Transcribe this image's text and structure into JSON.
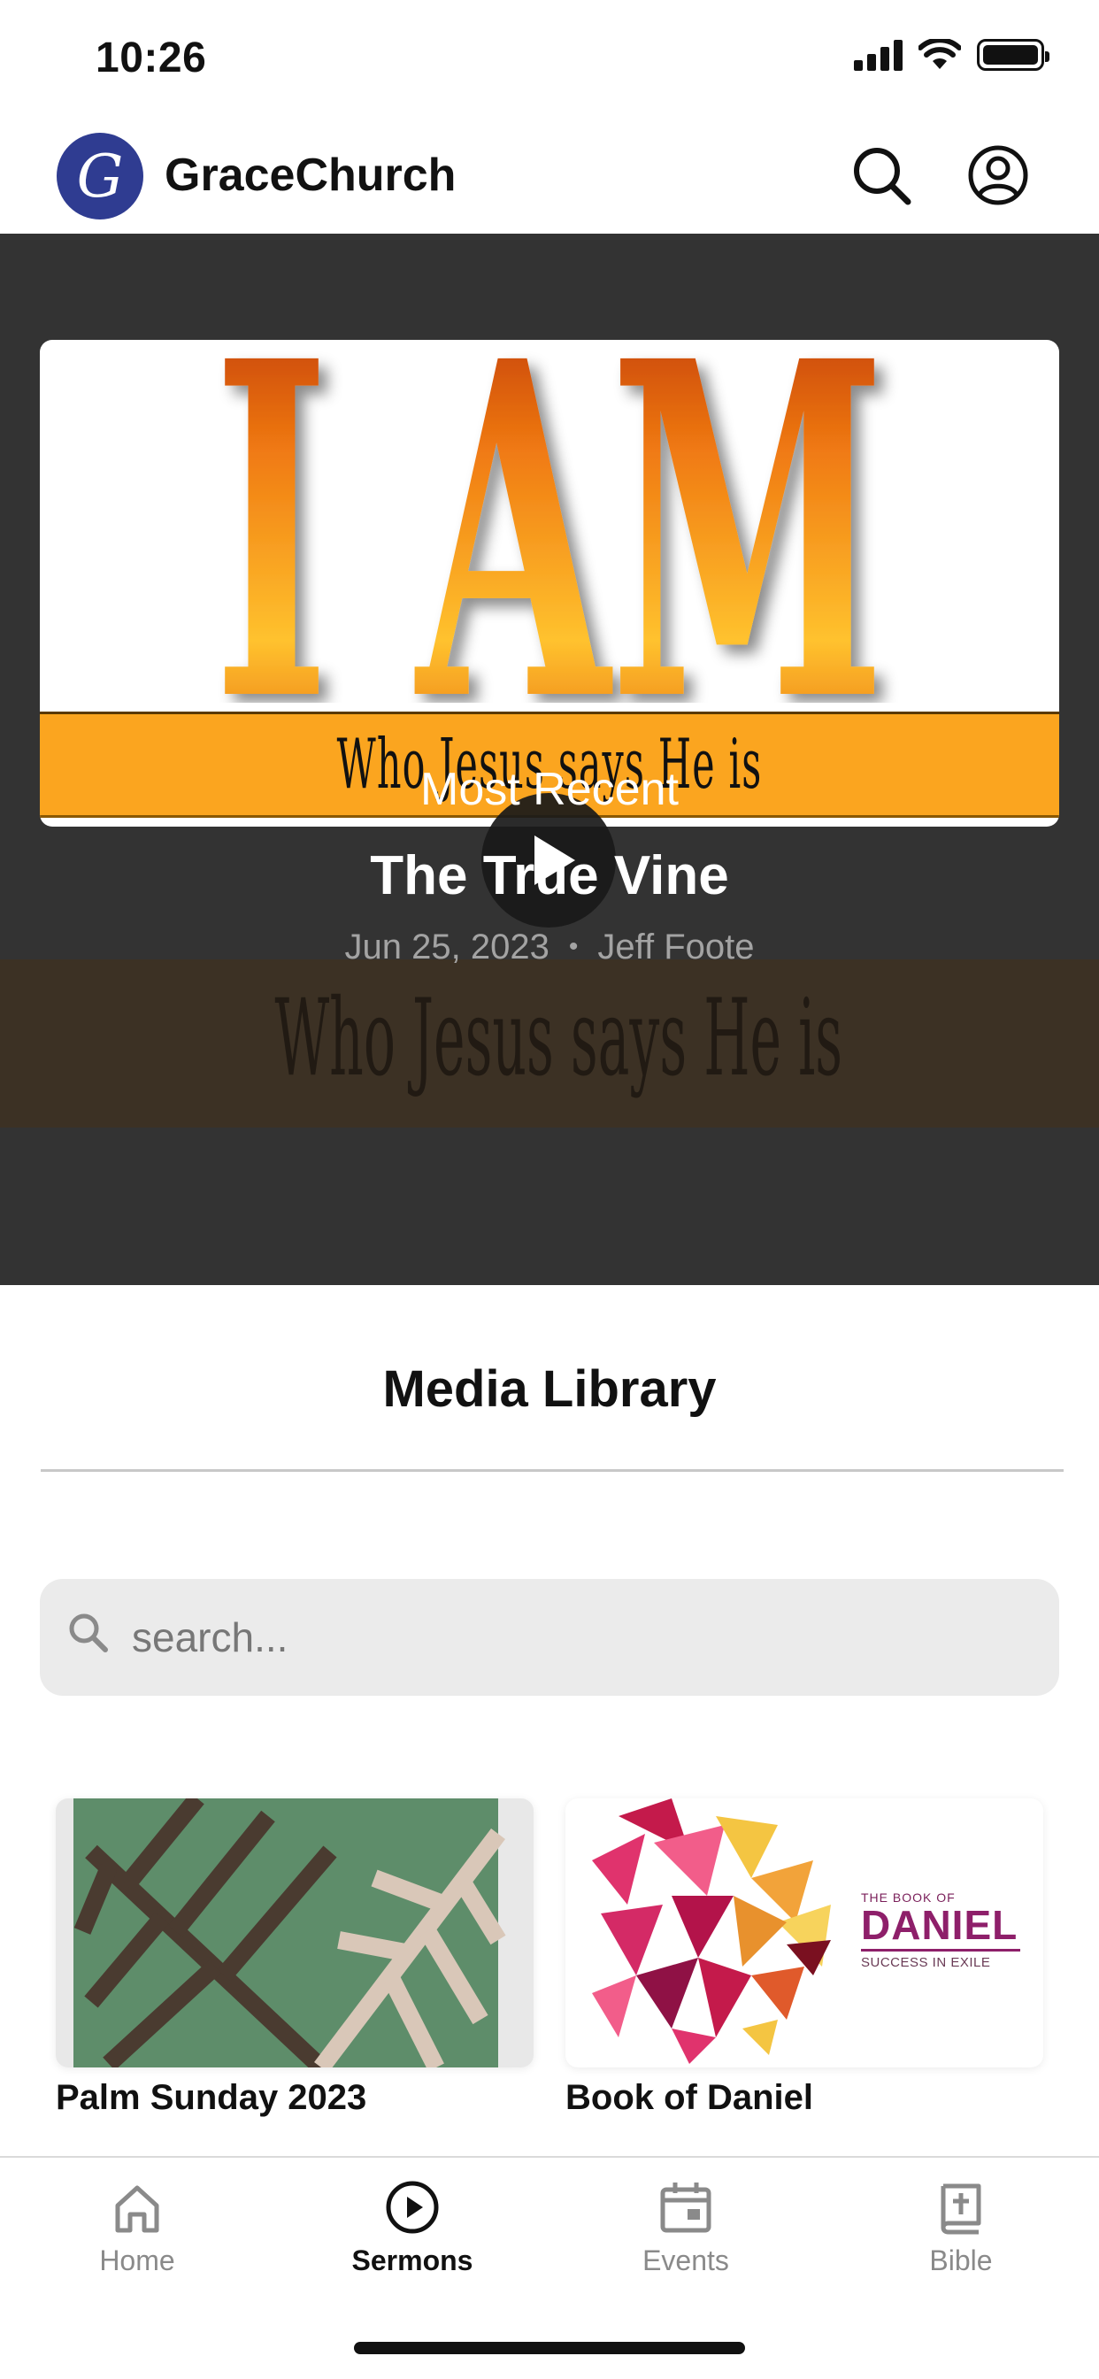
{
  "status_bar": {
    "time": "10:26"
  },
  "header": {
    "logo_letter": "G",
    "app_name": "GraceChurch"
  },
  "hero": {
    "banner_headline": "I AM",
    "banner_tagline": "Who Jesus says He is",
    "section_label": "Most Recent",
    "sermon_title": "The True Vine",
    "date": "Jun 25, 2023",
    "separator": "•",
    "speaker": "Jeff Foote"
  },
  "library": {
    "title": "Media Library",
    "search_placeholder": "search...",
    "cards": [
      {
        "label": "Palm Sunday 2023"
      },
      {
        "label": "Book of Daniel",
        "art_small": "THE BOOK OF",
        "art_big": "DANIEL",
        "art_sub": "SUCCESS IN EXILE"
      }
    ]
  },
  "tabs": [
    {
      "label": "Home",
      "icon": "home-icon",
      "active": false
    },
    {
      "label": "Sermons",
      "icon": "play-circle-icon",
      "active": true
    },
    {
      "label": "Events",
      "icon": "calendar-icon",
      "active": false
    },
    {
      "label": "Bible",
      "icon": "bible-icon",
      "active": false
    }
  ],
  "colors": {
    "brand": "#2f3c91",
    "hero_bg": "#333333",
    "banner_orange": "#fba51f"
  }
}
